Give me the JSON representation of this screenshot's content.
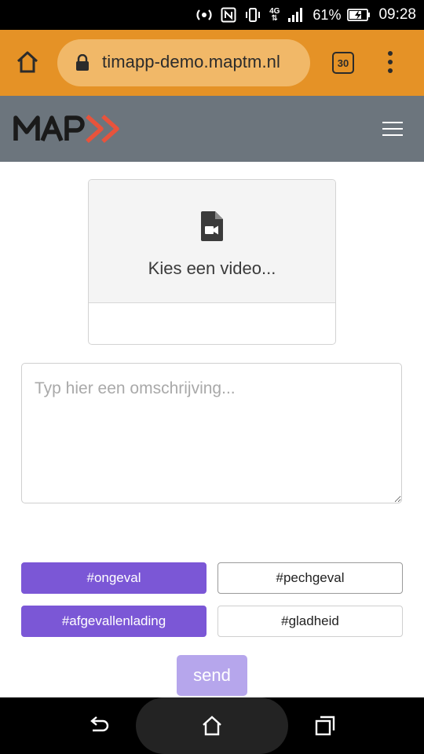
{
  "status_bar": {
    "battery_percent": "61%",
    "time": "09:28",
    "network_label": "4G",
    "icons": [
      "hotspot-icon",
      "nfc-icon",
      "vibrate-icon",
      "mobile-data-icon",
      "signal-icon",
      "battery-charging-icon"
    ]
  },
  "browser": {
    "url": "timapp-demo.maptm.nl",
    "tab_count": "30",
    "colors": {
      "toolbar": "#e59226",
      "url_pill": "#f1b868"
    }
  },
  "site_header": {
    "logo_text": "MAP",
    "colors": {
      "background": "#6c757d",
      "logo_accent": "#e8533c"
    }
  },
  "upload": {
    "label": "Kies een video..."
  },
  "description": {
    "placeholder": "Typ hier een omschrijving...",
    "value": ""
  },
  "tags": [
    {
      "label": "#ongeval",
      "selected": true
    },
    {
      "label": "#pechgeval",
      "selected": false
    },
    {
      "label": "#afgevallenlading",
      "selected": true
    },
    {
      "label": "#gladheid",
      "selected": false
    }
  ],
  "send_label": "send",
  "colors": {
    "tag_active": "#7b57d6",
    "send_disabled": "#b6a6ec"
  }
}
